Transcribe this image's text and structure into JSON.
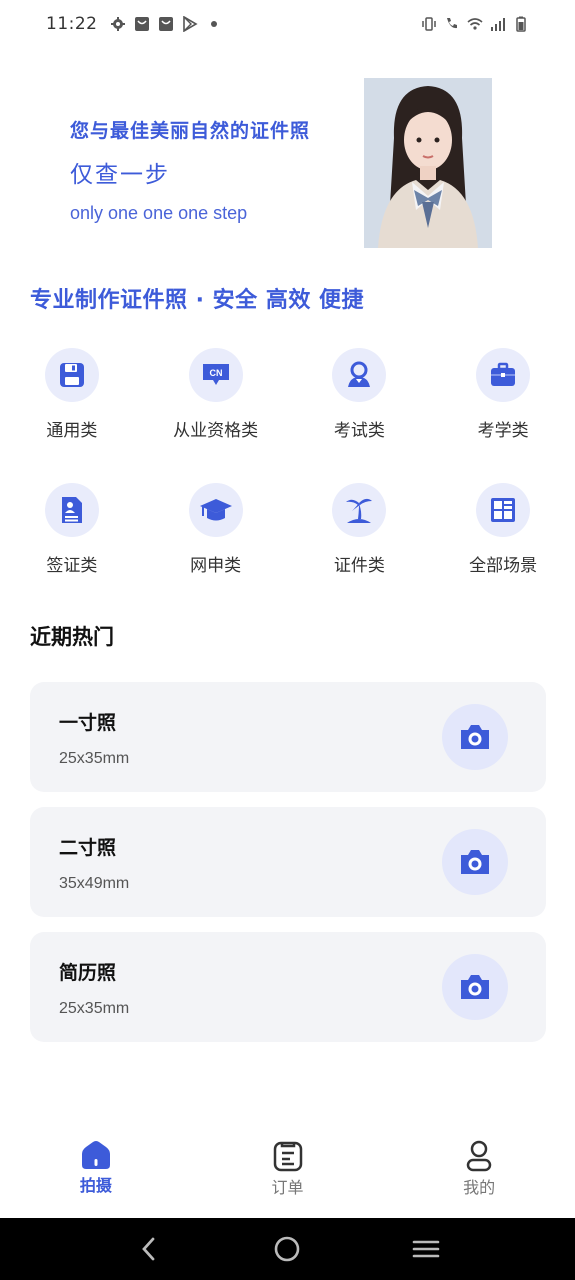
{
  "status_bar": {
    "time": "11:22"
  },
  "banner": {
    "title": "您与最佳美丽自然的证件照",
    "subtitle": "仅查一步",
    "english": "only one one one step"
  },
  "slogan": "专业制作证件照 · 安全 高效 便捷",
  "categories": [
    {
      "label": "通用类",
      "icon": "floppy-disk-icon"
    },
    {
      "label": "从业资格类",
      "icon": "cn-badge-icon"
    },
    {
      "label": "考试类",
      "icon": "person-pin-icon"
    },
    {
      "label": "考学类",
      "icon": "briefcase-icon"
    },
    {
      "label": "签证类",
      "icon": "document-person-icon"
    },
    {
      "label": "网申类",
      "icon": "graduation-cap-icon"
    },
    {
      "label": "证件类",
      "icon": "palm-tree-icon"
    },
    {
      "label": "全部场景",
      "icon": "grid-layout-icon"
    }
  ],
  "recent": {
    "title": "近期热门",
    "items": [
      {
        "name": "一寸照",
        "size": "25x35mm"
      },
      {
        "name": "二寸照",
        "size": "35x49mm"
      },
      {
        "name": "简历照",
        "size": "25x35mm"
      }
    ]
  },
  "tabs": [
    {
      "label": "拍摄",
      "active": true
    },
    {
      "label": "订单",
      "active": false
    },
    {
      "label": "我的",
      "active": false
    }
  ],
  "colors": {
    "accent": "#3d5bd9",
    "card_bg": "#f3f4f7",
    "icon_bg": "#e9ecfb"
  }
}
